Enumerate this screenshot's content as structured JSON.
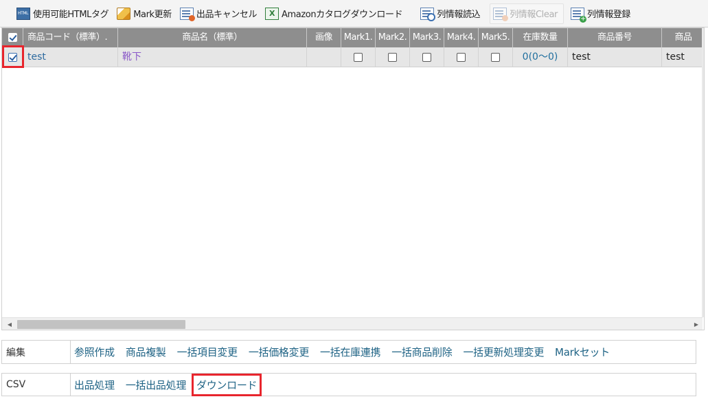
{
  "toolbar": {
    "buttons": [
      {
        "label": "使用可能HTMLタグ",
        "icon": "html-tag-icon",
        "enabled": true
      },
      {
        "label": "Mark更新",
        "icon": "pencil-icon",
        "enabled": true
      },
      {
        "label": "出品キャンセル",
        "icon": "cancel-listing-icon",
        "enabled": true
      },
      {
        "label": "Amazonカタログダウンロード",
        "icon": "excel-icon",
        "enabled": true
      },
      {
        "label": "列情報読込",
        "icon": "column-load-icon",
        "enabled": true
      },
      {
        "label": "列情報Clear",
        "icon": "column-clear-icon",
        "enabled": false
      },
      {
        "label": "列情報登録",
        "icon": "column-register-icon",
        "enabled": true
      }
    ]
  },
  "grid": {
    "header_checkbox_checked": true,
    "columns": [
      {
        "key": "select",
        "label": ""
      },
      {
        "key": "code",
        "label": "商品コード（標準）."
      },
      {
        "key": "name",
        "label": "商品名（標準）"
      },
      {
        "key": "image",
        "label": "画像"
      },
      {
        "key": "mark1",
        "label": "Mark1."
      },
      {
        "key": "mark2",
        "label": "Mark2."
      },
      {
        "key": "mark3",
        "label": "Mark3."
      },
      {
        "key": "mark4",
        "label": "Mark4."
      },
      {
        "key": "mark5",
        "label": "Mark5."
      },
      {
        "key": "stock",
        "label": "在庫数量"
      },
      {
        "key": "product_no",
        "label": "商品番号"
      },
      {
        "key": "product_extra",
        "label": "商品"
      }
    ],
    "rows": [
      {
        "selected": true,
        "code": "test",
        "name": "靴下",
        "image": "",
        "marks": [
          false,
          false,
          false,
          false,
          false
        ],
        "stock": "0(0～0)",
        "product_no": "test",
        "product_extra": "test"
      }
    ]
  },
  "edit_panel": {
    "label": "編集",
    "links": [
      "参照作成",
      "商品複製",
      "一括項目変更",
      "一括価格変更",
      "一括在庫連携",
      "一括商品削除",
      "一括更新処理変更",
      "Markセット"
    ]
  },
  "csv_panel": {
    "label": "CSV",
    "links": [
      "出品処理",
      "一括出品処理",
      "ダウンロード"
    ]
  },
  "colors": {
    "header_bg": "#8e8e8e",
    "row_bg": "#e6e6e6",
    "link": "#1f6385",
    "highlight": "#e8252d"
  }
}
